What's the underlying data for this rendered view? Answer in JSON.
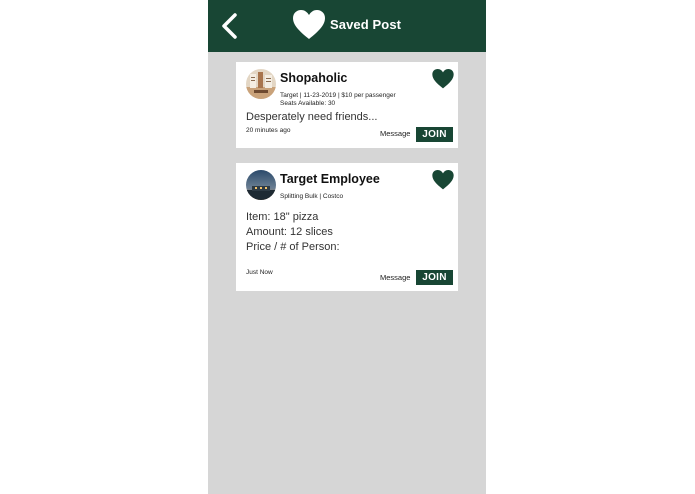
{
  "header": {
    "title": "Saved Post",
    "back_icon": "chevron-left-icon",
    "heart_icon": "heart-icon"
  },
  "colors": {
    "primary": "#184634",
    "background": "#d6d6d6",
    "card": "#ffffff"
  },
  "posts": [
    {
      "name": "Shopaholic",
      "meta_line1": "Target | 11-23-2019 | $10 per passenger",
      "meta_line2": "Seats Available: 30",
      "body": [
        "Desperately need friends..."
      ],
      "time": "20 minutes ago",
      "message_label": "Message",
      "join_label": "JOIN"
    },
    {
      "name": "Target Employee",
      "meta_line1": "Splitting Bulk | Costco",
      "body": [
        "Item: 18\" pizza",
        "Amount: 12 slices",
        "Price / # of Person:"
      ],
      "time": "Just Now",
      "message_label": "Message",
      "join_label": "JOIN"
    }
  ]
}
